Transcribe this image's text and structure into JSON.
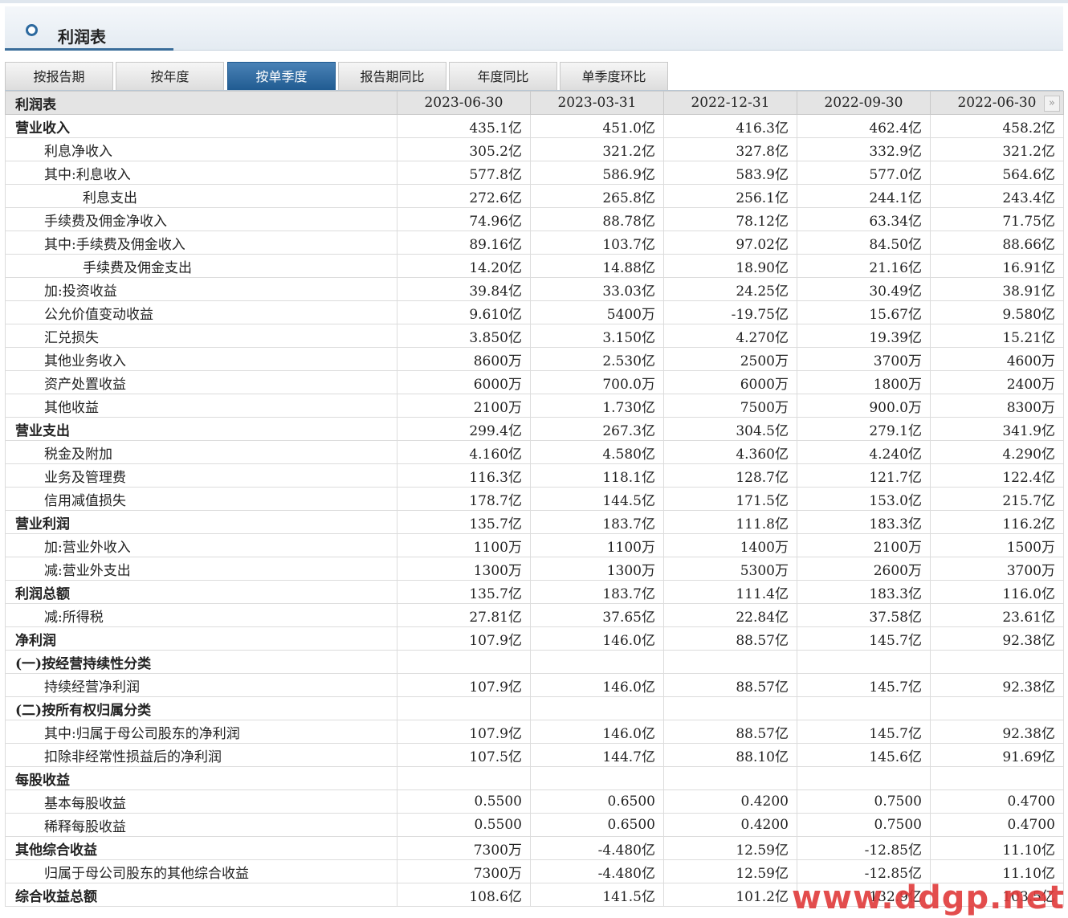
{
  "header": {
    "title": "利润表"
  },
  "tabs": [
    {
      "label": "按报告期",
      "active": false
    },
    {
      "label": "按年度",
      "active": false
    },
    {
      "label": "按单季度",
      "active": true
    },
    {
      "label": "报告期同比",
      "active": false
    },
    {
      "label": "年度同比",
      "active": false
    },
    {
      "label": "单季度环比",
      "active": false
    }
  ],
  "table": {
    "corner": "利润表",
    "columns": [
      "2023-06-30",
      "2023-03-31",
      "2022-12-31",
      "2022-09-30",
      "2022-06-30"
    ],
    "rows": [
      {
        "label": "营业收入",
        "level": 0,
        "values": [
          "435.1亿",
          "451.0亿",
          "416.3亿",
          "462.4亿",
          "458.2亿"
        ]
      },
      {
        "label": "利息净收入",
        "level": 1,
        "values": [
          "305.2亿",
          "321.2亿",
          "327.8亿",
          "332.9亿",
          "321.2亿"
        ]
      },
      {
        "label": "其中:利息收入",
        "level": 1,
        "values": [
          "577.8亿",
          "586.9亿",
          "583.9亿",
          "577.0亿",
          "564.6亿"
        ]
      },
      {
        "label": "利息支出",
        "level": 2,
        "values": [
          "272.6亿",
          "265.8亿",
          "256.1亿",
          "244.1亿",
          "243.4亿"
        ]
      },
      {
        "label": "手续费及佣金净收入",
        "level": 1,
        "values": [
          "74.96亿",
          "88.78亿",
          "78.12亿",
          "63.34亿",
          "71.75亿"
        ]
      },
      {
        "label": "其中:手续费及佣金收入",
        "level": 1,
        "values": [
          "89.16亿",
          "103.7亿",
          "97.02亿",
          "84.50亿",
          "88.66亿"
        ]
      },
      {
        "label": "手续费及佣金支出",
        "level": 2,
        "values": [
          "14.20亿",
          "14.88亿",
          "18.90亿",
          "21.16亿",
          "16.91亿"
        ]
      },
      {
        "label": "加:投资收益",
        "level": 1,
        "values": [
          "39.84亿",
          "33.03亿",
          "24.25亿",
          "30.49亿",
          "38.91亿"
        ]
      },
      {
        "label": "公允价值变动收益",
        "level": 1,
        "values": [
          "9.610亿",
          "5400万",
          "-19.75亿",
          "15.67亿",
          "9.580亿"
        ]
      },
      {
        "label": "汇兑损失",
        "level": 1,
        "values": [
          "3.850亿",
          "3.150亿",
          "4.270亿",
          "19.39亿",
          "15.21亿"
        ]
      },
      {
        "label": "其他业务收入",
        "level": 1,
        "values": [
          "8600万",
          "2.530亿",
          "2500万",
          "3700万",
          "4600万"
        ]
      },
      {
        "label": "资产处置收益",
        "level": 1,
        "values": [
          "6000万",
          "700.0万",
          "6000万",
          "1800万",
          "2400万"
        ]
      },
      {
        "label": "其他收益",
        "level": 1,
        "values": [
          "2100万",
          "1.730亿",
          "7500万",
          "900.0万",
          "8300万"
        ]
      },
      {
        "label": "营业支出",
        "level": 0,
        "values": [
          "299.4亿",
          "267.3亿",
          "304.5亿",
          "279.1亿",
          "341.9亿"
        ]
      },
      {
        "label": "税金及附加",
        "level": 1,
        "values": [
          "4.160亿",
          "4.580亿",
          "4.360亿",
          "4.240亿",
          "4.290亿"
        ]
      },
      {
        "label": "业务及管理费",
        "level": 1,
        "values": [
          "116.3亿",
          "118.1亿",
          "128.7亿",
          "121.7亿",
          "122.4亿"
        ]
      },
      {
        "label": "信用减值损失",
        "level": 1,
        "values": [
          "178.7亿",
          "144.5亿",
          "171.5亿",
          "153.0亿",
          "215.7亿"
        ]
      },
      {
        "label": "营业利润",
        "level": 0,
        "values": [
          "135.7亿",
          "183.7亿",
          "111.8亿",
          "183.3亿",
          "116.2亿"
        ]
      },
      {
        "label": "加:营业外收入",
        "level": 1,
        "values": [
          "1100万",
          "1100万",
          "1400万",
          "2100万",
          "1500万"
        ]
      },
      {
        "label": "减:营业外支出",
        "level": 1,
        "values": [
          "1300万",
          "1300万",
          "5300万",
          "2600万",
          "3700万"
        ]
      },
      {
        "label": "利润总额",
        "level": 0,
        "values": [
          "135.7亿",
          "183.7亿",
          "111.4亿",
          "183.3亿",
          "116.0亿"
        ]
      },
      {
        "label": "减:所得税",
        "level": 1,
        "values": [
          "27.81亿",
          "37.65亿",
          "22.84亿",
          "37.58亿",
          "23.61亿"
        ]
      },
      {
        "label": "净利润",
        "level": 0,
        "values": [
          "107.9亿",
          "146.0亿",
          "88.57亿",
          "145.7亿",
          "92.38亿"
        ]
      },
      {
        "label": "(一)按经营持续性分类",
        "level": 0,
        "values": [
          "",
          "",
          "",
          "",
          ""
        ]
      },
      {
        "label": "持续经营净利润",
        "level": 1,
        "values": [
          "107.9亿",
          "146.0亿",
          "88.57亿",
          "145.7亿",
          "92.38亿"
        ]
      },
      {
        "label": "(二)按所有权归属分类",
        "level": 0,
        "values": [
          "",
          "",
          "",
          "",
          ""
        ]
      },
      {
        "label": "其中:归属于母公司股东的净利润",
        "level": 1,
        "values": [
          "107.9亿",
          "146.0亿",
          "88.57亿",
          "145.7亿",
          "92.38亿"
        ]
      },
      {
        "label": "扣除非经常性损益后的净利润",
        "level": 1,
        "values": [
          "107.5亿",
          "144.7亿",
          "88.10亿",
          "145.6亿",
          "91.69亿"
        ]
      },
      {
        "label": "每股收益",
        "level": 0,
        "values": [
          "",
          "",
          "",
          "",
          ""
        ]
      },
      {
        "label": "基本每股收益",
        "level": 1,
        "values": [
          "0.5500",
          "0.6500",
          "0.4200",
          "0.7500",
          "0.4700"
        ]
      },
      {
        "label": "稀释每股收益",
        "level": 1,
        "values": [
          "0.5500",
          "0.6500",
          "0.4200",
          "0.7500",
          "0.4700"
        ]
      },
      {
        "label": "其他综合收益",
        "level": 0,
        "values": [
          "7300万",
          "-4.480亿",
          "12.59亿",
          "-12.85亿",
          "11.10亿"
        ]
      },
      {
        "label": "归属于母公司股东的其他综合收益",
        "level": 1,
        "values": [
          "7300万",
          "-4.480亿",
          "12.59亿",
          "-12.85亿",
          "11.10亿"
        ]
      },
      {
        "label": "综合收益总额",
        "level": 0,
        "values": [
          "108.6亿",
          "141.5亿",
          "101.2亿",
          "132.9亿",
          "103.5亿"
        ]
      }
    ]
  },
  "icons": {
    "next": "double-chevron-right-icon"
  },
  "watermark": "www.ddgp.net"
}
